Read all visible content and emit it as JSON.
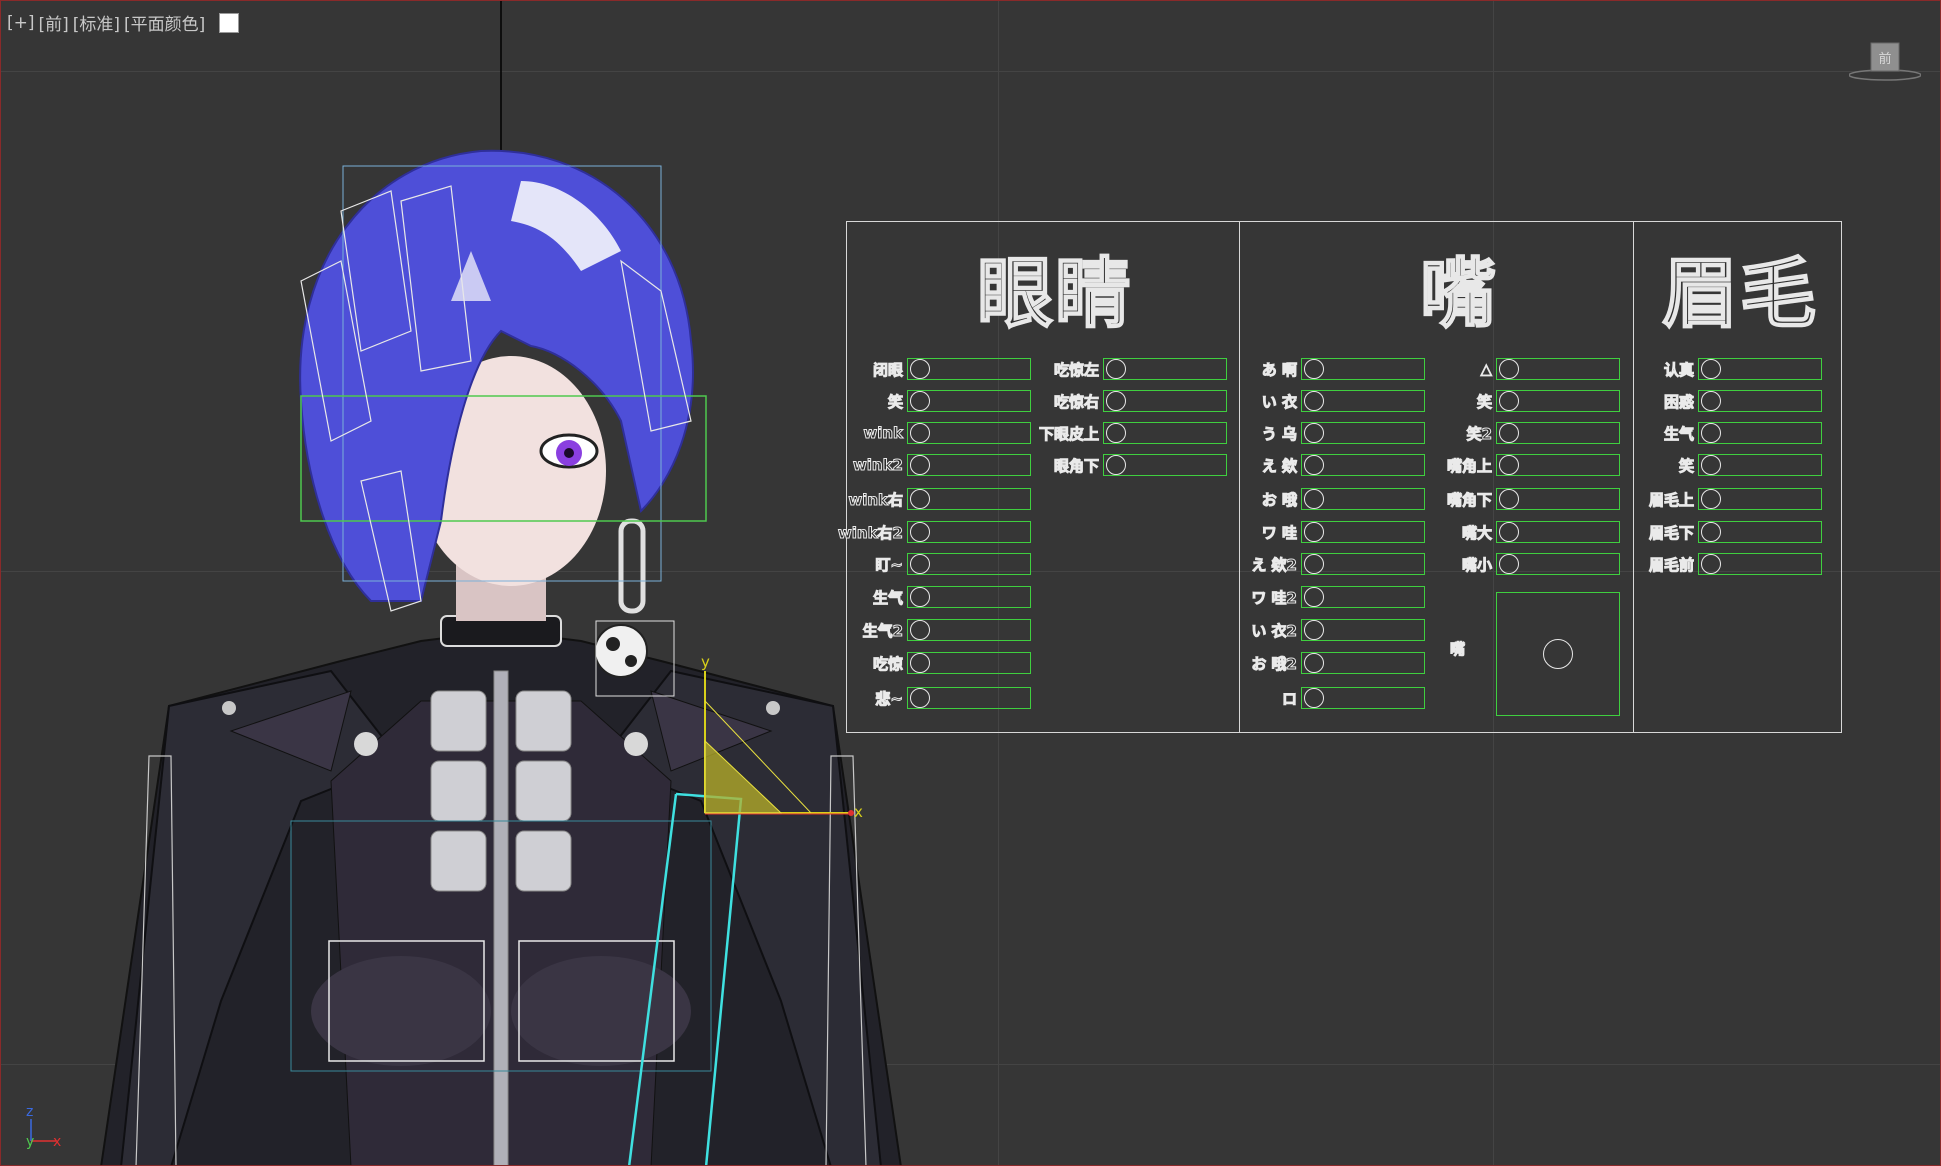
{
  "viewport": {
    "label_parts": [
      "[+]",
      "[前]",
      "[标准]",
      "[平面颜色]"
    ],
    "viewcube_label": "前",
    "gizmo_axes": {
      "y": "y",
      "x": "x"
    },
    "corner_axes": {
      "z": "z",
      "y": "y",
      "x": "x"
    }
  },
  "panel": {
    "eyes": {
      "title": "眼睛",
      "left_items": [
        "闭眼",
        "笑",
        "wink",
        "wink2",
        "wink右",
        "wink右2",
        "盯~",
        "生气",
        "生气2",
        "吃惊",
        "悲~"
      ],
      "right_items": [
        "吃惊左",
        "吃惊右",
        "下眼皮上",
        "眼角下"
      ]
    },
    "mouth": {
      "title": "嘴",
      "left_items": [
        "あ 啊",
        "い 衣",
        "う 乌",
        "え 欸",
        "お 哦",
        "ワ 哇",
        "え 欸2",
        "ワ 哇2",
        "い 衣2",
        "お 哦2",
        "ロ"
      ],
      "right_items": [
        "△",
        "笑",
        "笑2",
        "嘴角上",
        "嘴角下",
        "嘴大",
        "嘴小"
      ],
      "pad_label": "嘴"
    },
    "brows": {
      "title": "眉毛",
      "items": [
        "认真",
        "困惑",
        "生气",
        "笑",
        "眉毛上",
        "眉毛下",
        "眉毛前"
      ]
    }
  },
  "colors": {
    "background": "#363636",
    "grid": "#444444",
    "slider_border": "#3fcf3f",
    "panel_outline": "#d8d8d8",
    "gizmo_yellow": "#d8d01a",
    "spline_cyan": "#3fe0e0"
  }
}
